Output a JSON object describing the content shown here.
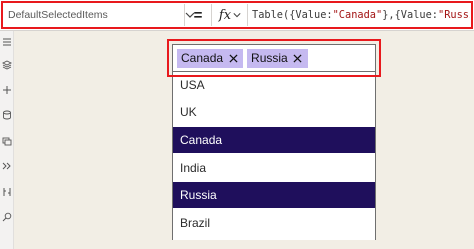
{
  "formula_bar": {
    "property": "DefaultSelectedItems",
    "equals": "=",
    "fx": "fx",
    "formula_prefix": "Table({Value: ",
    "formula_str1": "\"Canada\"",
    "formula_mid": "},{Value:",
    "formula_str2": "\"Russia\"",
    "formula_suffix": "})"
  },
  "combo_box": {
    "chips": [
      {
        "label": "Canada"
      },
      {
        "label": "Russia"
      }
    ]
  },
  "dropdown": {
    "items": [
      {
        "label": "USA",
        "selected": false
      },
      {
        "label": "UK",
        "selected": false
      },
      {
        "label": "Canada",
        "selected": true
      },
      {
        "label": "India",
        "selected": false
      },
      {
        "label": "Russia",
        "selected": true
      },
      {
        "label": "Brazil",
        "selected": false
      }
    ]
  },
  "colors": {
    "accent_red": "#e8191d",
    "chip_bg": "#c5b9f0",
    "selected_bg": "#1f0f5c",
    "canvas_bg": "#f2eee5"
  }
}
